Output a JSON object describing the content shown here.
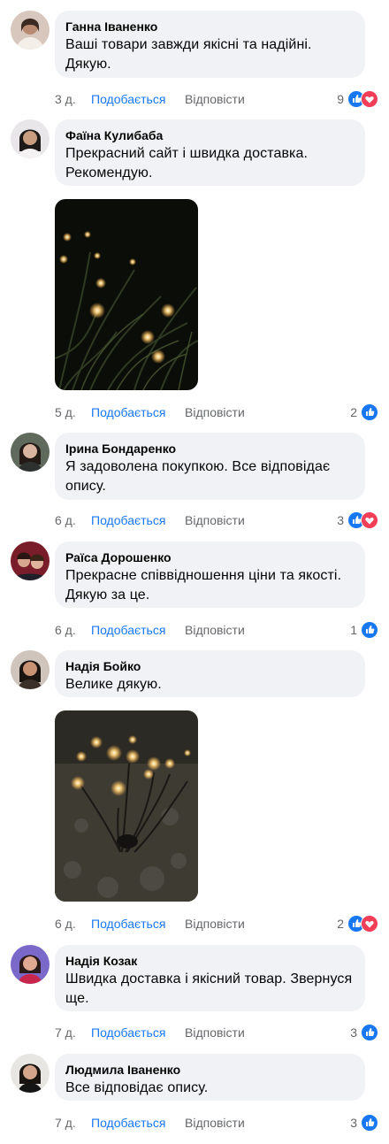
{
  "colors": {
    "like_blue": "#1877f2",
    "heart_red": "#f33e58",
    "muted": "#65676b",
    "bubble": "#f0f2f5"
  },
  "actions": {
    "like": "Подобається",
    "reply": "Відповісти"
  },
  "comments": [
    {
      "author": "Ганна Іваненко",
      "text": "Ваші товари завжди якісні та надійні. Дякую.",
      "time": "3 д.",
      "reactions": "9",
      "icons": [
        "like-icon",
        "heart-icon"
      ]
    },
    {
      "author": "Фаїна Кулибаба",
      "text": "Прекрасний сайт і швидка доставка. Рекомендую.",
      "time": "5 д.",
      "reactions": "2",
      "icons": [
        "like-icon"
      ],
      "photo": "garden lights photo"
    },
    {
      "author": "Ірина Бондаренко",
      "text": "Я задоволена покупкою. Все відповідає опису.",
      "time": "6 д.",
      "reactions": "3",
      "icons": [
        "like-icon",
        "heart-icon"
      ]
    },
    {
      "author": "Раїса Дорошенко",
      "text": "Прекрасне співвідношення ціни та якості. Дякую за це.",
      "time": "6 д.",
      "reactions": "1",
      "icons": [
        "like-icon"
      ]
    },
    {
      "author": "Надія Бойко",
      "text": "Велике дякую.",
      "time": "6 д.",
      "reactions": "2",
      "icons": [
        "like-icon",
        "heart-icon"
      ],
      "photo": "garden lights photo"
    },
    {
      "author": "Надія Козак",
      "text": "Швидка доставка і якісний товар. Звернуся ще.",
      "time": "7 д.",
      "reactions": "3",
      "icons": [
        "like-icon"
      ]
    },
    {
      "author": "Людмила Іваненко",
      "text": "Все відповідає опису.",
      "time": "7 д.",
      "reactions": "3",
      "icons": [
        "like-icon"
      ]
    }
  ]
}
